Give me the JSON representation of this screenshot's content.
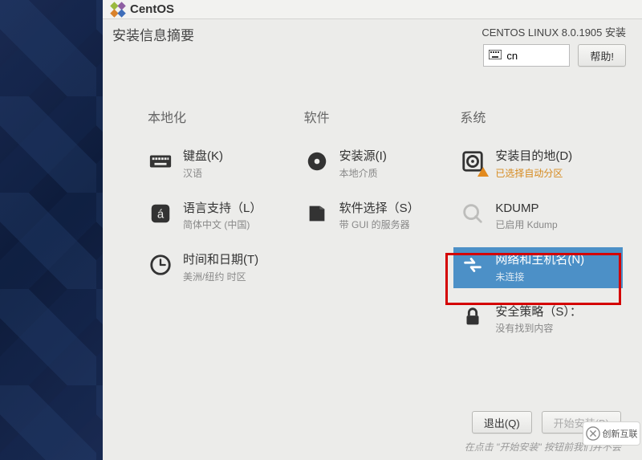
{
  "brand": "CentOS",
  "header": {
    "title": "安装信息摘要",
    "product": "CENTOS LINUX 8.0.1905 安装",
    "lang_short": "cn",
    "help_label": "帮助!"
  },
  "columns": {
    "localization": {
      "heading": "本地化",
      "keyboard": {
        "title": "键盘(K)",
        "sub": "汉语"
      },
      "language": {
        "title": "语言支持（L）",
        "sub": "简体中文 (中国)"
      },
      "datetime": {
        "title": "时间和日期(T)",
        "sub": "美洲/纽约 时区"
      }
    },
    "software": {
      "heading": "软件",
      "source": {
        "title": "安装源(I)",
        "sub": "本地介质"
      },
      "selection": {
        "title": "软件选择（S）",
        "sub": "带 GUI 的服务器"
      }
    },
    "system": {
      "heading": "系统",
      "destination": {
        "title": "安装目的地(D)",
        "sub": "已选择自动分区"
      },
      "kdump": {
        "title": "KDUMP",
        "sub": "已启用 Kdump"
      },
      "network": {
        "title": "网络和主机名(N)",
        "sub": "未连接"
      },
      "security": {
        "title": "安全策略（S）：",
        "sub": "没有找到内容"
      }
    }
  },
  "footer": {
    "quit": "退出(Q)",
    "begin": "开始安装(B)",
    "hint": "在点击 \"开始安装\" 按钮前我们并不会"
  },
  "watermark": "创新互联"
}
